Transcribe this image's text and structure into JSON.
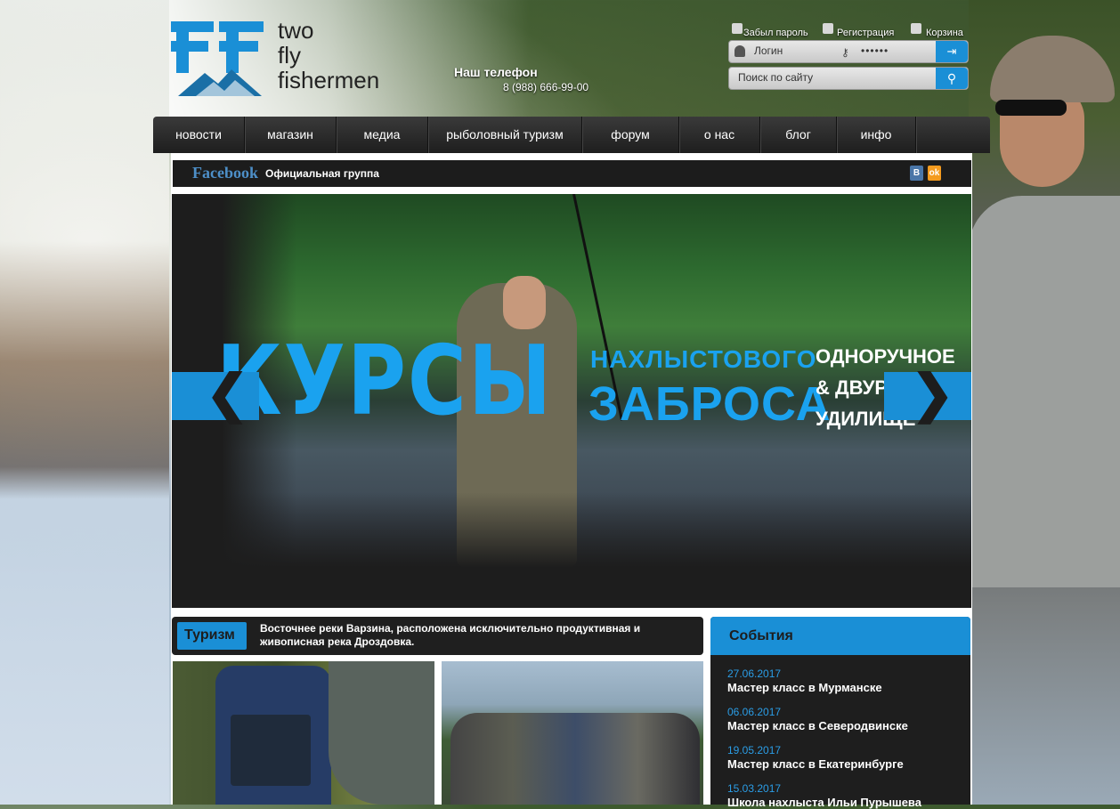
{
  "logo": {
    "line1": "two",
    "line2": "fly",
    "line3": "fishermen"
  },
  "phone": {
    "title": "Наш телефон",
    "number": "8 (988) 666-99-00"
  },
  "auth": {
    "forgot": "Забыл пароль",
    "register": "Регистрация",
    "cart": "Корзина",
    "login_placeholder": "Логин",
    "password_value": "••••••"
  },
  "search": {
    "placeholder": "Поиск по сайту"
  },
  "nav": {
    "items": [
      "новости",
      "магазин",
      "медиа",
      "рыболовный туризм",
      "форум",
      "о нас",
      "блог",
      "инфо"
    ]
  },
  "facebook": {
    "brand": "Facebook",
    "label": "Официальная группа",
    "vk": "В",
    "ok": "ok"
  },
  "banner": {
    "big": "КУРСЫ",
    "line1": "НАХЛЫСТОВОГО",
    "line2": "ЗАБРОСА",
    "side1": "ОДНОРУЧНОЕ",
    "side2": "& ДВУРУ",
    "side3": "УДИЛИЩЕ",
    "prev": "❮",
    "next": "❯"
  },
  "tourism": {
    "tab": "Туризм",
    "text": "Восточнее реки Варзина, расположена исключительно продуктивная и живописная река Дроздовка."
  },
  "events": {
    "title": "События",
    "items": [
      {
        "date": "27.06.2017",
        "title": "Мастер класс в Мурманске"
      },
      {
        "date": "06.06.2017",
        "title": "Мастер класс в Северодвинске"
      },
      {
        "date": "19.05.2017",
        "title": "Мастер класс в Екатеринбурге"
      },
      {
        "date": "15.03.2017",
        "title": "Школа нахлыста Ильи Пурышева"
      }
    ]
  },
  "colors": {
    "accent": "#1a8fd6",
    "dark": "#1e1e1e"
  }
}
